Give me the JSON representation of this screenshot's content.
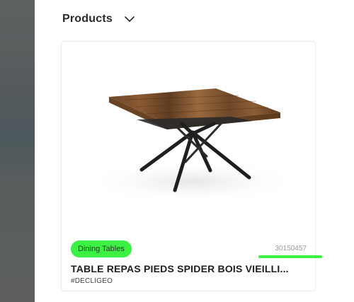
{
  "header": {
    "title": "Products",
    "toggle_icon": "chevron-down-icon"
  },
  "card": {
    "image_description_icon": "dining-table-image",
    "category": "Dining Tables",
    "product_id": "30150457",
    "name": "TABLE REPAS PIEDS SPIDER BOIS VIEILLI...",
    "tag": "#DECLIGEO"
  },
  "colors": {
    "badge": "#3df044",
    "overlay": "#585d5e",
    "text_dark": "#1f1f1f",
    "text_muted": "#9a9a9a"
  }
}
